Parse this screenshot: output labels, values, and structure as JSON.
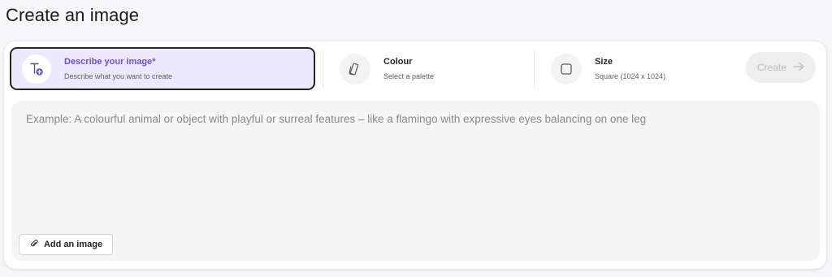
{
  "page": {
    "title": "Create an image"
  },
  "options": {
    "describe": {
      "title": "Describe your image*",
      "subtitle": "Describe what you want to create",
      "icon": "text-add-icon",
      "selected": true
    },
    "colour": {
      "title": "Colour",
      "subtitle": "Select a palette",
      "icon": "palette-swatch-icon"
    },
    "size": {
      "title": "Size",
      "subtitle": "Square (1024 x 1024)",
      "icon": "square-icon"
    }
  },
  "create_button": {
    "label": "Create",
    "icon": "arrow-right-icon",
    "enabled": false
  },
  "prompt": {
    "value": "",
    "placeholder": "Example: A colourful animal or object with playful or surreal features – like a flamingo with expressive eyes balancing on one leg"
  },
  "add_image_button": {
    "label": "Add an image",
    "icon": "paperclip-icon"
  },
  "colors": {
    "accent": "#6e4ed2",
    "selected_bg": "#ede9fd",
    "page_bg": "#f7f7f9"
  }
}
